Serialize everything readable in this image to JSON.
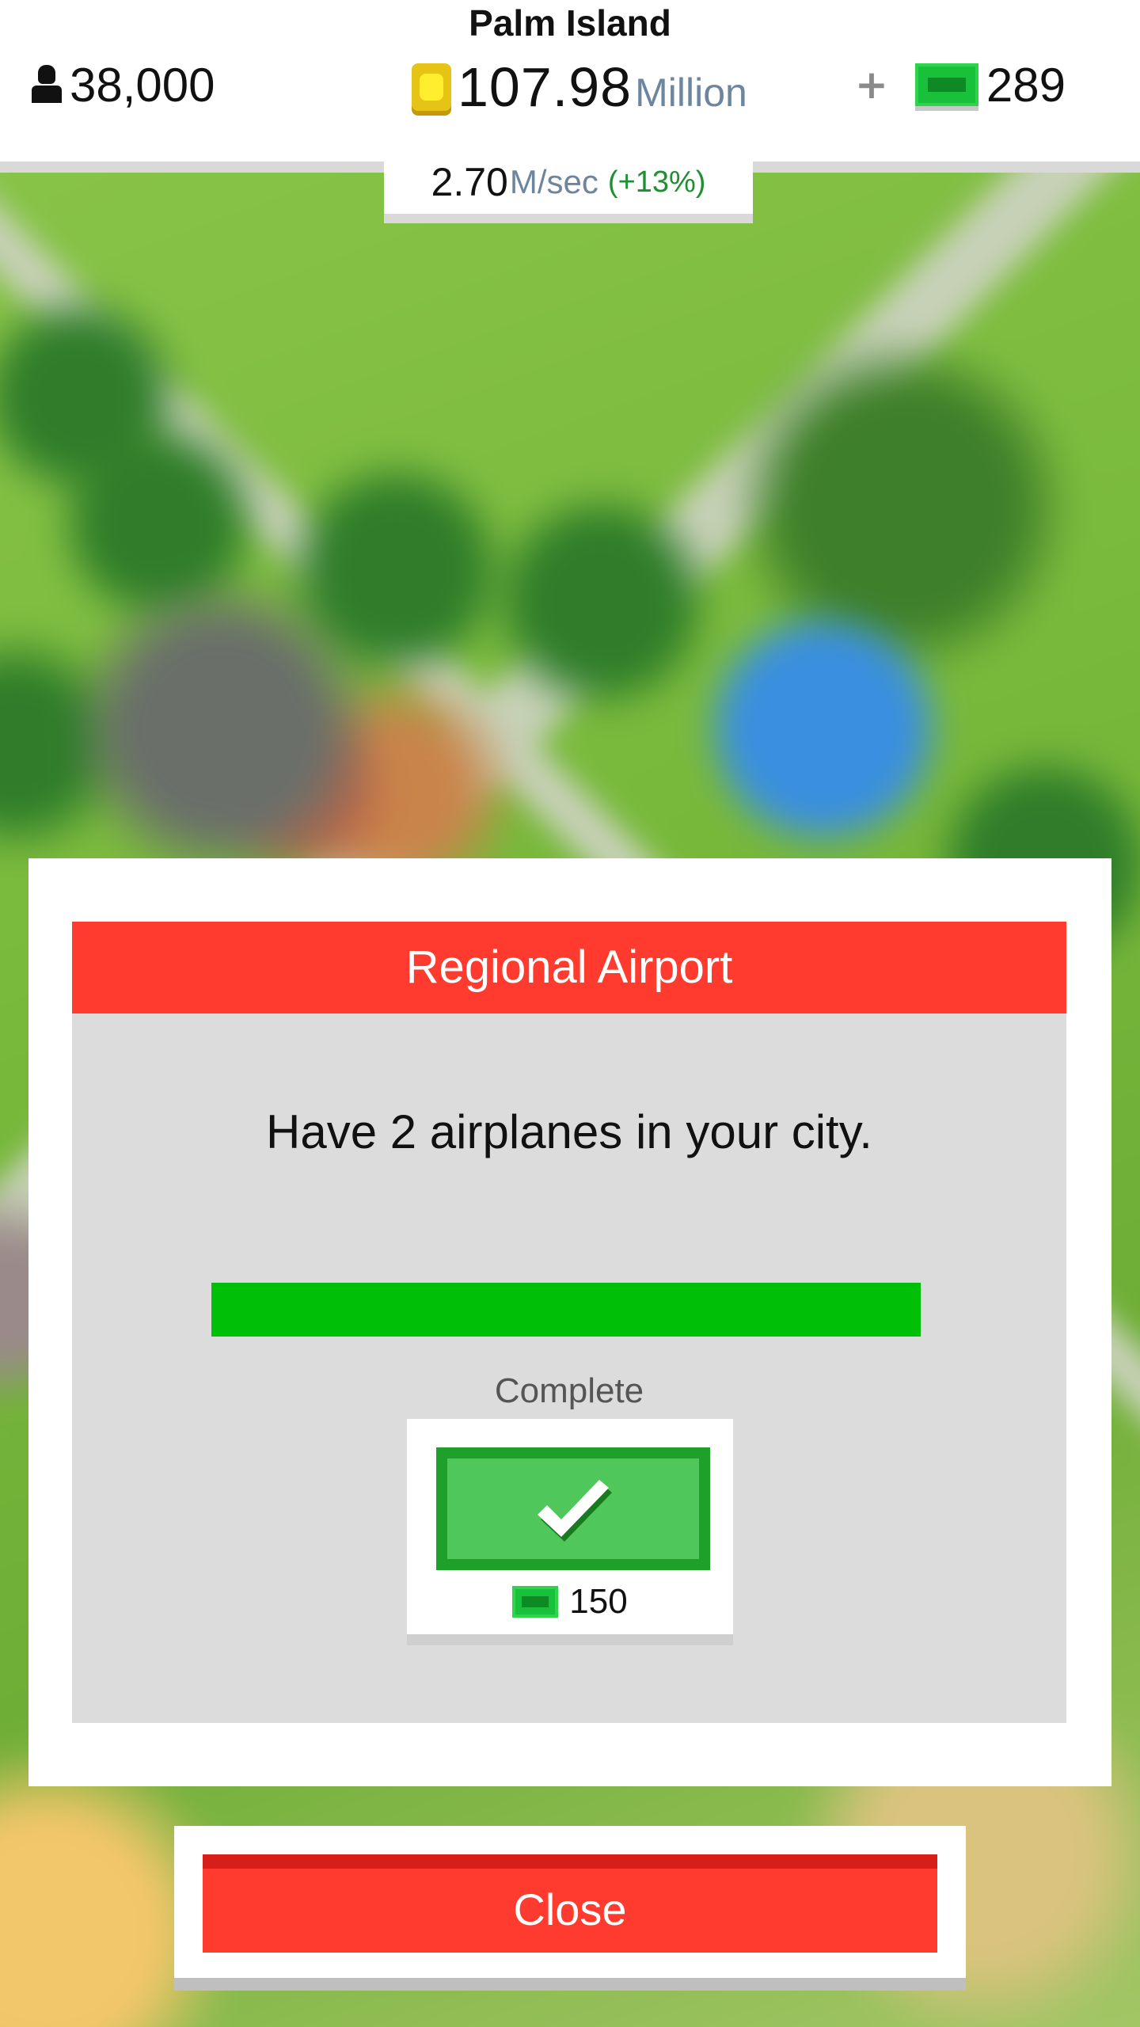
{
  "hud": {
    "city_name": "Palm Island",
    "population": "38,000",
    "money_value": "107.98",
    "money_unit": "Million",
    "add_symbol": "+",
    "gems": "289",
    "income_rate": "2.70",
    "income_unit": "M/sec",
    "income_bonus": "(+13%)"
  },
  "modal": {
    "title": "Regional Airport",
    "goal": "Have 2 airplanes in your city.",
    "progress": 1.0,
    "status": "Complete",
    "reward_amount": "150"
  },
  "close_label": "Close",
  "colors": {
    "header_red": "#ff3b2f",
    "progress_green": "#00bf07",
    "claim_green": "#4fc75a",
    "money_unit_blue": "#6e85a0",
    "bonus_green": "#1f8f32"
  },
  "icons": [
    "person-icon",
    "coin-icon",
    "gem-icon",
    "checkmark-icon"
  ]
}
